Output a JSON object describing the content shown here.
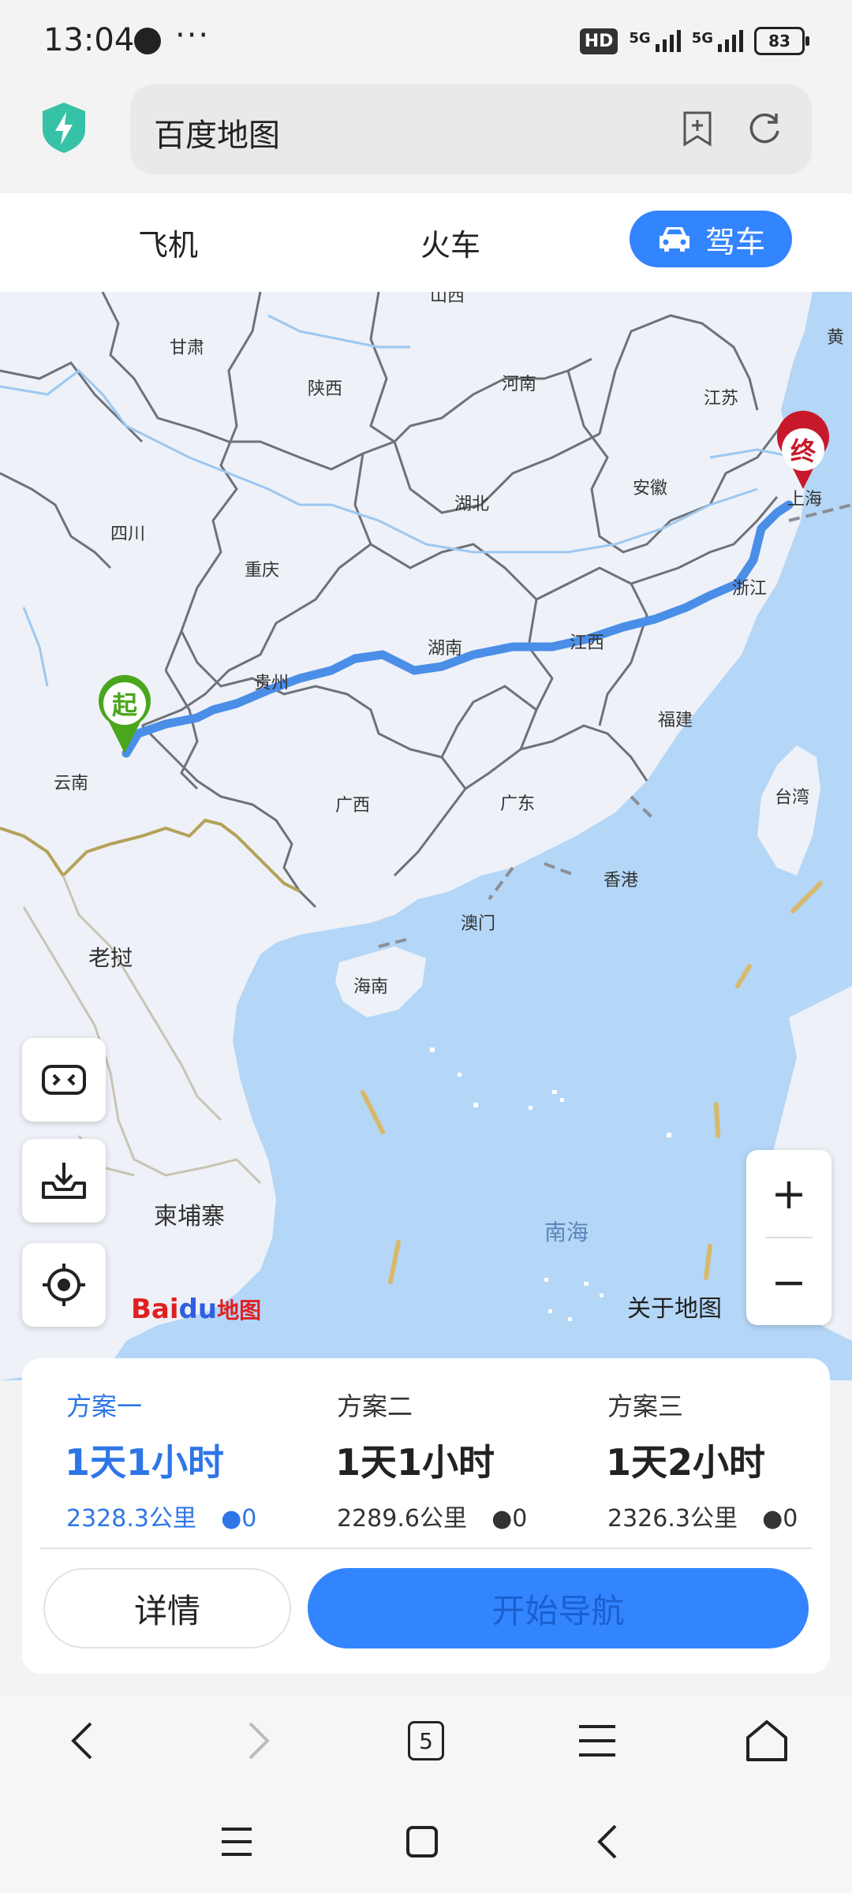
{
  "status_bar": {
    "time": "13:04",
    "more": "···",
    "hd": "HD",
    "net1": "5G",
    "net2": "5G",
    "battery": "83"
  },
  "browser": {
    "title": "百度地图"
  },
  "modes": {
    "flight": "飞机",
    "train": "火车",
    "drive": "驾车"
  },
  "map": {
    "labels": {
      "shanxi": "山西",
      "gansu": "甘肃",
      "shaanxi": "陕西",
      "henan": "河南",
      "jiangsu": "江苏",
      "huangli": "黄",
      "anhui": "安徽",
      "shanghai": "上海",
      "hubei": "湖北",
      "sichuan": "四川",
      "chongqing": "重庆",
      "zhejiang": "浙江",
      "hunan": "湖南",
      "jiangxi": "江西",
      "guizhou": "贵州",
      "fujian": "福建",
      "yunnan": "云南",
      "guangxi": "广西",
      "guangdong": "广东",
      "taiwan": "台湾",
      "xianggang": "香港",
      "aomen": "澳门",
      "laos": "老挝",
      "hainan": "海南",
      "cambodia": "柬埔寨",
      "nanhai": "南海"
    },
    "start_marker": "起",
    "end_marker": "终",
    "zoom_in": "+",
    "zoom_out": "−",
    "about": "关于地图",
    "logo_bai": "Bai",
    "logo_du": "du",
    "logo_map": "地图"
  },
  "colors": {
    "accent": "#3385ff",
    "route": "#4a8ee8",
    "sea": "#b4d6f7",
    "land": "#eef1f7",
    "start": "#4aa61c",
    "end": "#c8192b"
  },
  "plans": [
    {
      "name": "方案一",
      "time": "1天1小时",
      "distance": "2328.3公里",
      "toll": "0"
    },
    {
      "name": "方案二",
      "time": "1天1小时",
      "distance": "2289.6公里",
      "toll": "0"
    },
    {
      "name": "方案三",
      "time": "1天2小时",
      "distance": "2326.3公里",
      "toll": "0"
    }
  ],
  "actions": {
    "detail": "详情",
    "navigate": "开始导航"
  },
  "nav": {
    "tabs_count": "5"
  },
  "icons": {
    "shield": "shield-bolt-icon",
    "bookmark": "add-bookmark-icon",
    "reload": "reload-icon",
    "car": "car-icon",
    "game": "gamepad-icon",
    "download": "download-icon",
    "locate": "locate-icon"
  }
}
